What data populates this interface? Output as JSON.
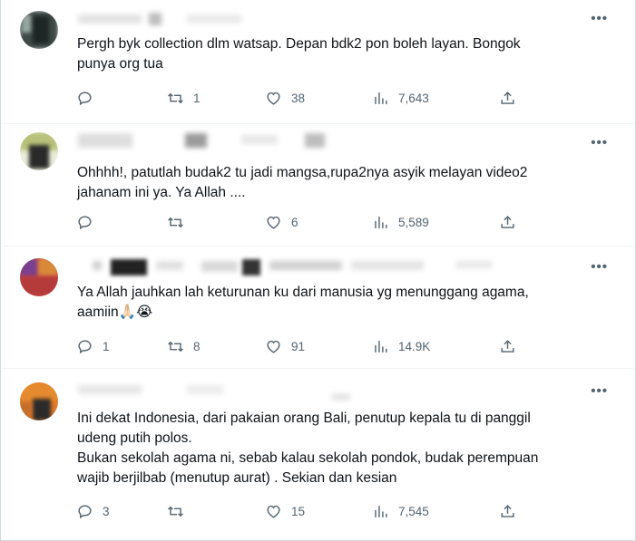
{
  "tweets": [
    {
      "text_lines": [
        "Pergh byk collection dlm watsap. Depan bdk2 pon boleh layan. Bongok",
        "punya org tua"
      ],
      "replies": "",
      "retweets": "1",
      "likes": "38",
      "views": "7,643"
    },
    {
      "text_lines": [
        "Ohhhh!, patutlah budak2 tu jadi mangsa,rupa2nya asyik melayan video2",
        "jahanam ini ya. Ya Allah ...."
      ],
      "replies": "",
      "retweets": "",
      "likes": "6",
      "views": "5,589"
    },
    {
      "text_lines": [
        "Ya Allah jauhkan lah keturunan ku dari manusia yg menunggang agama,",
        "aamiin🙏🏻😭"
      ],
      "replies": "1",
      "retweets": "8",
      "likes": "91",
      "views": "14.9K"
    },
    {
      "text_lines": [
        "Ini dekat Indonesia, dari pakaian orang Bali, penutup kepala tu di panggil",
        "udeng putih polos.",
        "Bukan sekolah agama ni, sebab kalau sekolah pondok, budak perempuan",
        "wajib berjilbab (menutup aurat) . Sekian dan kesian"
      ],
      "replies": "3",
      "retweets": "",
      "likes": "15",
      "views": "7,545"
    }
  ],
  "icons": {
    "reply": "reply-icon",
    "retweet": "retweet-icon",
    "like": "heart-icon",
    "views": "views-icon",
    "share": "share-icon",
    "more": "more-icon"
  },
  "more_label": "•••"
}
